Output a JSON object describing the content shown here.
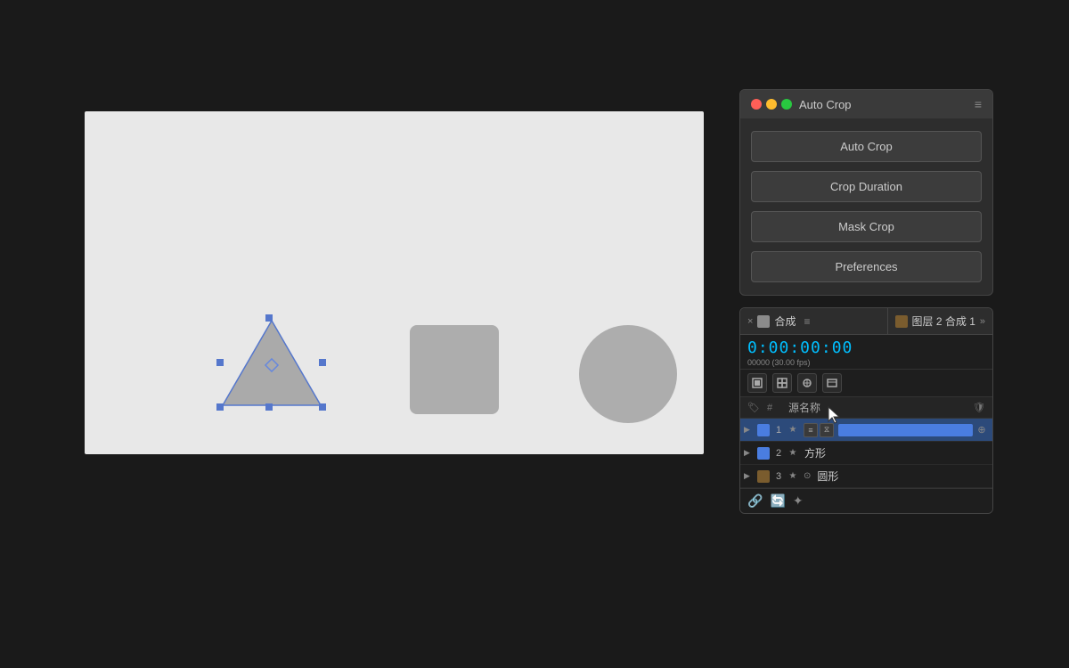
{
  "canvas": {
    "background_color": "#e8e8e8"
  },
  "auto_crop_panel": {
    "title": "Auto Crop",
    "menu_icon": "≡",
    "buttons": {
      "auto_crop": "Auto Crop",
      "crop_duration": "Crop Duration",
      "mask_crop": "Mask Crop",
      "preferences": "Preferences"
    },
    "window_controls": {
      "close": "close",
      "minimize": "minimize",
      "maximize": "maximize"
    }
  },
  "composition_panel": {
    "header_left": {
      "close": "×",
      "title": "合成",
      "menu": "≡"
    },
    "header_right": {
      "title": "图层 2 合成 1",
      "expand": "»"
    },
    "timecode": {
      "value": "0:00:00:00",
      "fps_label": "00000 (30.00 fps)"
    },
    "columns": {
      "hash": "#",
      "name": "源名称"
    },
    "layers": [
      {
        "num": "1",
        "name": "",
        "swatch": "blue",
        "has_bar": true
      },
      {
        "num": "2",
        "name": "方形",
        "swatch": "blue"
      },
      {
        "num": "3",
        "name": "圆形",
        "swatch": "brown"
      }
    ]
  }
}
